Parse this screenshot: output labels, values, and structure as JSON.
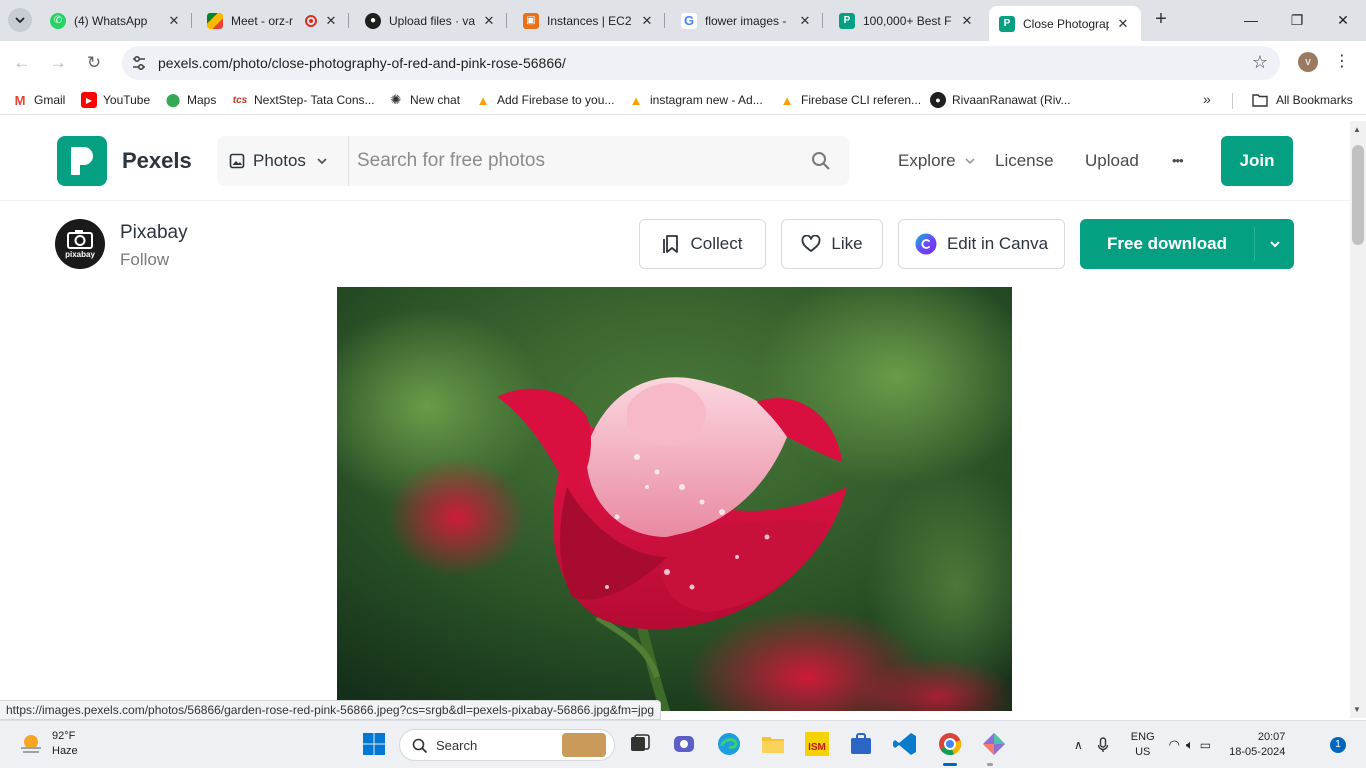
{
  "browser": {
    "tabs": [
      {
        "label": "(4) WhatsApp",
        "icon": "whatsapp-icon"
      },
      {
        "label": "Meet - orz-r",
        "icon": "google-meet-icon"
      },
      {
        "label": "Upload files · va",
        "icon": "github-icon"
      },
      {
        "label": "Instances | EC2 |",
        "icon": "aws-icon"
      },
      {
        "label": "flower images -",
        "icon": "google-icon"
      },
      {
        "label": "100,000+ Best F",
        "icon": "pexels-icon"
      },
      {
        "label": "Close Photograp",
        "icon": "pexels-icon"
      }
    ],
    "address_url": "pexels.com/photo/close-photography-of-red-and-pink-rose-56866/",
    "profile_initial": "v",
    "bookmarks": [
      {
        "label": "Gmail"
      },
      {
        "label": "YouTube"
      },
      {
        "label": "Maps"
      },
      {
        "label": "NextStep- Tata Cons..."
      },
      {
        "label": "New chat"
      },
      {
        "label": "Add Firebase to you..."
      },
      {
        "label": "instagram new - Ad..."
      },
      {
        "label": "Firebase CLI referen..."
      },
      {
        "label": "RivaanRanawat (Riv..."
      }
    ],
    "all_bookmarks_label": "All Bookmarks",
    "status_url": "https://images.pexels.com/photos/56866/garden-rose-red-pink-56866.jpeg?cs=srgb&dl=pexels-pixabay-56866.jpg&fm=jpg"
  },
  "site": {
    "brand": "Pexels",
    "brand_color": "#05a081",
    "search_type": "Photos",
    "search_placeholder": "Search for free photos",
    "nav": {
      "explore": "Explore",
      "license": "License",
      "upload": "Upload",
      "more": "•••",
      "join": "Join"
    }
  },
  "photo": {
    "author_name": "Pixabay",
    "author_logo_text": "pixabay",
    "follow_label": "Follow",
    "collect_label": "Collect",
    "like_label": "Like",
    "canva_label": "Edit in Canva",
    "download_label": "Free download"
  },
  "taskbar": {
    "weather_temp": "92°F",
    "weather_desc": "Haze",
    "search_label": "Search",
    "lang_primary": "ENG",
    "lang_secondary": "US",
    "time": "20:07",
    "date": "18-05-2024",
    "notifications": "1"
  }
}
